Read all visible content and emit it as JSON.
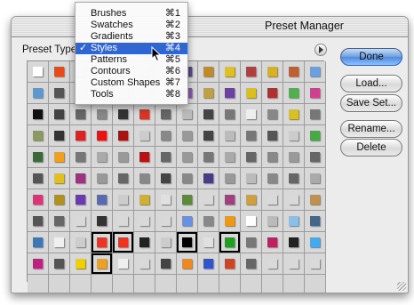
{
  "window": {
    "title": "Preset Manager"
  },
  "preset_type": {
    "label": "Preset Type:",
    "selected": "Styles"
  },
  "menu": {
    "items": [
      {
        "label": "Brushes",
        "shortcut": "⌘1",
        "checked": false,
        "highlighted": false
      },
      {
        "label": "Swatches",
        "shortcut": "⌘2",
        "checked": false,
        "highlighted": false
      },
      {
        "label": "Gradients",
        "shortcut": "⌘3",
        "checked": false,
        "highlighted": false
      },
      {
        "label": "Styles",
        "shortcut": "⌘4",
        "checked": true,
        "highlighted": true
      },
      {
        "label": "Patterns",
        "shortcut": "⌘5",
        "checked": false,
        "highlighted": false
      },
      {
        "label": "Contours",
        "shortcut": "⌘6",
        "checked": false,
        "highlighted": false
      },
      {
        "label": "Custom Shapes",
        "shortcut": "⌘7",
        "checked": false,
        "highlighted": false
      },
      {
        "label": "Tools",
        "shortcut": "⌘8",
        "checked": false,
        "highlighted": false
      }
    ],
    "check_glyph": "✓"
  },
  "buttons": {
    "done": "Done",
    "load": "Load...",
    "save_set": "Save Set...",
    "rename": "Rename...",
    "delete": "Delete"
  },
  "colors": {
    "highlight": "#2f66d2",
    "default_button": "#4f8ae0",
    "selection_outline": "#000000"
  },
  "style_swatches": [
    [
      "#ffffff",
      "#e84a1a",
      "#d9d9d9",
      "#d9d9d9",
      "#d9d9d9",
      "#d9d9d9",
      "#d9d9d9",
      "#5a4a8a",
      "#c08a2a",
      "#e0c020",
      "#b04040",
      "#d8b020",
      "#c06030",
      "#6aa0e0"
    ],
    [
      "#5a9ad0",
      "#555555",
      "#d9d9d9",
      "#d9d9d9",
      "#d9d9d9",
      "#d9d9d9",
      "#d9d9d9",
      "#8a5ab0",
      "#c0a040",
      "#6a40a0",
      "#d8c020",
      "#b03030",
      "#50b050",
      "#d04090"
    ],
    [
      "#111111",
      "#444444",
      "#666666",
      "#888888",
      "#333333",
      "#dd3322",
      "#666666",
      "#bbbbbb",
      "#444444",
      "#777777",
      "#eeeeee",
      "#888888",
      "#d8c020",
      "#777777"
    ],
    [
      "#8a9a60",
      "#333333",
      "#dd2222",
      "#ee1111",
      "#aa1111",
      "#cccccc",
      "#888888",
      "#999999",
      "#444444",
      "#bbbbbb",
      "#777777",
      "#555555",
      "#cccccc",
      "#44aa44"
    ],
    [
      "#3a6a3a",
      "#f0a020",
      "#777777",
      "#aaaaaa",
      "#999999",
      "#bb1111",
      "#666666",
      "#999999",
      "#777777",
      "#aaaaaa",
      "#666666",
      "#888888",
      "#999999",
      "#666666"
    ],
    [
      "#555555",
      "#e0c020",
      "#a03080",
      "#999999",
      "#666666",
      "#888888",
      "#444444",
      "#888888",
      "#4a3a8a",
      "#999999",
      "#bbbbbb",
      "#888888",
      "#666666",
      "#aaaaaa"
    ],
    [
      "#dd3377",
      "#b09020",
      "#6a3ab0",
      "#5a6ab0",
      "#cccccc",
      "#d0b030",
      "#e0e0e0",
      "#5a8a3a",
      "#d8d8d8",
      "#a04080",
      "#d0a040",
      "#d9d9d9",
      "#d9d9d9",
      "#c09050"
    ],
    [
      "#555555",
      "#666666",
      "#d9d9d9",
      "#333333",
      "#d9d9d9",
      "#d9d9d9",
      "#d9d9d9",
      "#6a90e0",
      "#888888",
      "#ee9911",
      "#ffffff",
      "#bbbbbb",
      "#88c0e8",
      "#446688"
    ],
    [
      "#3a78b8",
      "#f0f0f0",
      "#cccccc",
      "#ee3322",
      "#ee3322",
      "#222222",
      "#cccccc",
      "#000000",
      "#e0e0e0",
      "#20a020",
      "#777777",
      "#c02060",
      "#222222",
      "#44aaee"
    ],
    [
      "#c02080",
      "#555555",
      "#f0d000",
      "#f0a020",
      "#eeeeee",
      "#d9d9d9",
      "#444444",
      "#ee8822",
      "#3355cc",
      "#cc4422",
      "#666666",
      "#d9d9d9",
      "#d9d9d9",
      "#d9d9d9"
    ]
  ],
  "empty_cells_after_row": 10,
  "selected_cells": [
    [
      8,
      3
    ],
    [
      8,
      4
    ],
    [
      8,
      7
    ],
    [
      8,
      9
    ],
    [
      9,
      3
    ]
  ]
}
